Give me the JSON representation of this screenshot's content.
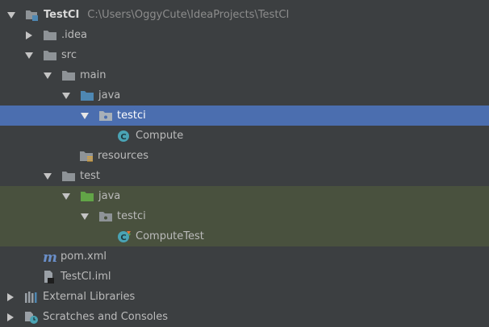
{
  "project": {
    "name": "TestCI",
    "path": "C:\\Users\\OggyCute\\IdeaProjects\\TestCI"
  },
  "tree": {
    "idea": ".idea",
    "src": "src",
    "main": "main",
    "main_java": "java",
    "main_pkg": "testci",
    "compute": "Compute",
    "resources": "resources",
    "test": "test",
    "test_java": "java",
    "test_pkg": "testci",
    "compute_test": "ComputeTest",
    "pom": "pom.xml",
    "iml": "TestCI.iml",
    "external_libraries": "External Libraries",
    "scratches": "Scratches and Consoles"
  },
  "icons": {
    "folder": "folder-icon",
    "source_folder": "source-folder-icon",
    "test_folder": "test-folder-icon",
    "package": "package-icon",
    "class": "java-class-icon",
    "maven": "maven-icon",
    "iml": "iml-file-icon",
    "libraries": "libraries-icon",
    "scratches": "scratches-icon"
  },
  "colors": {
    "background": "#3c3f41",
    "selection": "#4b6eaf",
    "test_scope": "#49513e",
    "folder": "#8e9397",
    "source_folder": "#4e87b2",
    "test_folder": "#62a447",
    "class_badge": "#4aa3b4"
  }
}
